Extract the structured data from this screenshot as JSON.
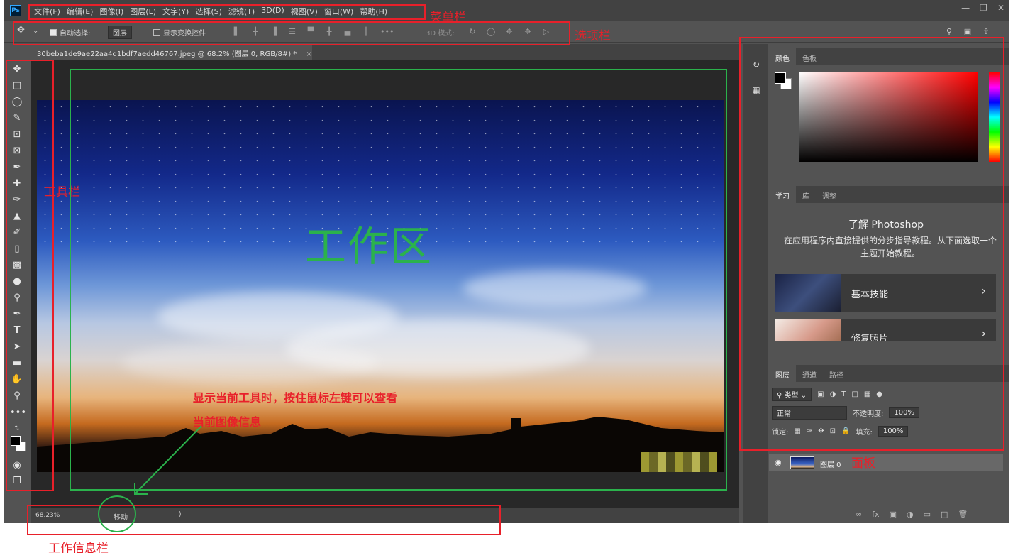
{
  "menubar": {
    "logo": "Ps",
    "items": [
      "文件(F)",
      "编辑(E)",
      "图像(I)",
      "图层(L)",
      "文字(Y)",
      "选择(S)",
      "滤镜(T)",
      "3D(D)",
      "视图(V)",
      "窗口(W)",
      "帮助(H)"
    ]
  },
  "options": {
    "auto_select_label": "自动选择:",
    "auto_select_value": "图层",
    "show_transform_label": "显示变换控件",
    "mode_3d_label": "3D 模式:"
  },
  "document": {
    "tab_title": "30beba1de9ae22aa4d1bdf7aedd46767.jpeg @ 68.2% (图层 0, RGB/8#) *",
    "close_glyph": "×"
  },
  "status": {
    "zoom": "68.23%",
    "info": "移动",
    "end": ")"
  },
  "panels": {
    "color_tabs": [
      "颜色",
      "色板"
    ],
    "learn_tabs": [
      "学习",
      "库",
      "调整"
    ],
    "learn_title": "了解 Photoshop",
    "learn_desc": "在应用程序内直接提供的分步指导教程。从下面选取一个主题开始教程。",
    "cards": [
      {
        "label": "基本技能"
      },
      {
        "label": "修复照片"
      }
    ],
    "layers_tabs": [
      "图层",
      "通道",
      "路径"
    ],
    "filter_kind": "类型",
    "blend_mode": "正常",
    "opacity_label": "不透明度:",
    "opacity_value": "100%",
    "lock_label": "锁定:",
    "fill_label": "填充:",
    "fill_value": "100%",
    "layer_name": "图层 0"
  },
  "annotations": {
    "menubar": "菜单栏",
    "optionsbar": "选项栏",
    "toolbar": "工具栏",
    "workspace": "工作区",
    "panels": "面板",
    "statusbar": "工作信息栏",
    "hint_line1": "显示当前工具时，按住鼠标左键可以查看",
    "hint_line2": "当前图像信息"
  },
  "colors": {
    "annotation_red": "#e8202a",
    "annotation_green": "#2bb24c",
    "ps_dark": "#424242",
    "ps_mid": "#535353"
  }
}
